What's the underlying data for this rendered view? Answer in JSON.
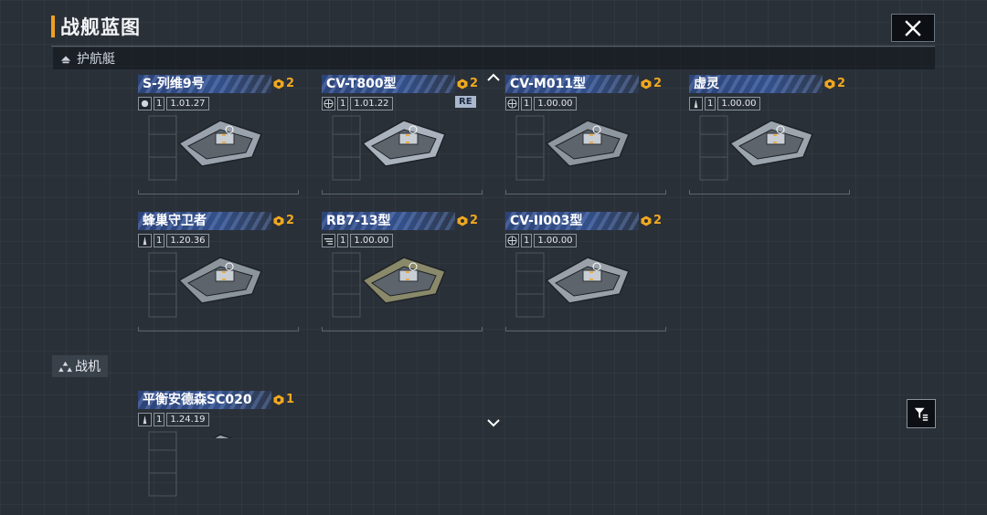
{
  "header": {
    "title": "战舰蓝图"
  },
  "sections": {
    "frigate": {
      "label": "护航艇"
    },
    "fighter": {
      "label": "战机"
    }
  },
  "cards": [
    {
      "name": "S-列维9号",
      "count": "2",
      "level": "1",
      "version": "1.01.27",
      "tag": ""
    },
    {
      "name": "CV-T800型",
      "count": "2",
      "level": "1",
      "version": "1.01.22",
      "tag": "RE"
    },
    {
      "name": "CV-M011型",
      "count": "2",
      "level": "1",
      "version": "1.00.00",
      "tag": ""
    },
    {
      "name": "虚灵",
      "count": "2",
      "level": "1",
      "version": "1.00.00",
      "tag": ""
    },
    {
      "name": "蜂巢守卫者",
      "count": "2",
      "level": "1",
      "version": "1.20.36",
      "tag": ""
    },
    {
      "name": "RB7-13型",
      "count": "2",
      "level": "1",
      "version": "1.00.00",
      "tag": ""
    },
    {
      "name": "CV-II003型",
      "count": "2",
      "level": "1",
      "version": "1.00.00",
      "tag": ""
    },
    {
      "name": "平衡安德森SC020",
      "count": "1",
      "level": "1",
      "version": "1.24.19",
      "tag": ""
    }
  ],
  "colors": {
    "accent": "#f0a020",
    "header_blue": "#2c4378",
    "background": "#2a3038"
  },
  "icons": {
    "close": "close-icon",
    "frigate": "frigate-icon",
    "fighter": "fighter-icon",
    "count": "blueprint-count-icon",
    "filter": "filter-icon",
    "scroll_up": "chevron-up-icon",
    "scroll_down": "chevron-down-icon"
  }
}
